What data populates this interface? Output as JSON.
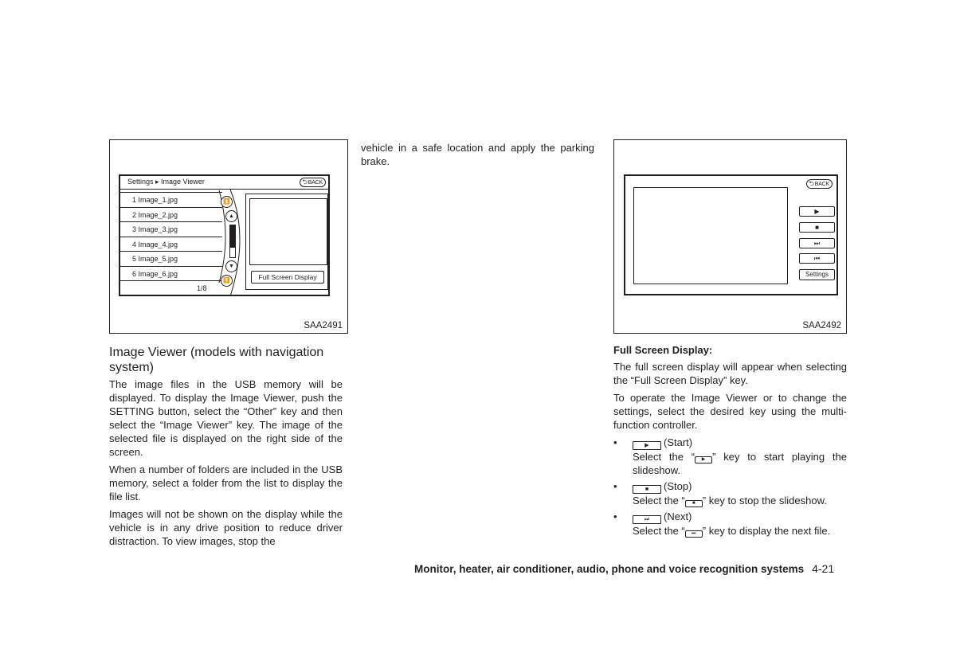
{
  "figure1": {
    "code": "SAA2491",
    "breadcrumb": "Settings ▸ Image Viewer",
    "back_label": "BACK",
    "back_icon": "return-arrow-icon",
    "files": [
      "1 Image_1.jpg",
      "2 Image_2.jpg",
      "3 Image_3.jpg",
      "4 Image_4.jpg",
      "5 Image_5.jpg",
      "6 Image_6.jpg"
    ],
    "page_indicator": "1/8",
    "scroll_buttons": {
      "page_up_icon": "double-up-chevron-icon",
      "up_icon": "up-chevron-icon",
      "down_icon": "down-chevron-icon",
      "page_down_icon": "double-down-chevron-icon"
    },
    "scroll_position_fraction": 0.7,
    "full_screen_button": "Full Screen Display"
  },
  "figure2": {
    "code": "SAA2492",
    "back_label": "BACK",
    "controls": [
      {
        "name": "play",
        "glyph": "▶"
      },
      {
        "name": "stop",
        "glyph": "■"
      },
      {
        "name": "next",
        "glyph": "⏭"
      },
      {
        "name": "previous",
        "glyph": "⏮"
      }
    ],
    "settings_label": "Settings"
  },
  "col1": {
    "heading": "Image Viewer (models with navigation system)",
    "paragraphs": [
      "The image files in the USB memory will be displayed. To display the Image Viewer, push the SETTING button, select the “Other” key and then select the “Image Viewer” key. The image of the selected file is displayed on the right side of the screen.",
      "When a number of folders are included in the USB memory, select a folder from the list to display the file list.",
      "Images will not be shown on the display while the vehicle is in any drive position to reduce driver distraction. To view images, stop the"
    ]
  },
  "col2": {
    "paragraph": "vehicle in a safe location and apply the parking brake."
  },
  "col3": {
    "heading": "Full Screen Display:",
    "paragraphs": [
      "The full screen display will appear when selecting the “Full Screen Display” key.",
      "To operate the Image Viewer or to change the settings, select the desired key using the multi-function controller."
    ],
    "bullets": [
      {
        "glyph": "▶",
        "label": "(Start)",
        "desc_before": "Select the “",
        "desc_after": "” key to start playing the slideshow."
      },
      {
        "glyph": "■",
        "label": "(Stop)",
        "desc_before": "Select the “",
        "desc_after": "” key to stop the slideshow."
      },
      {
        "glyph": "⏭",
        "label": "(Next)",
        "desc_before": "Select the “",
        "desc_after": "” key to display the next file."
      }
    ],
    "bullet_char": "•"
  },
  "footer": {
    "section": "Monitor, heater, air conditioner, audio, phone and voice recognition systems",
    "page": "4-21"
  }
}
